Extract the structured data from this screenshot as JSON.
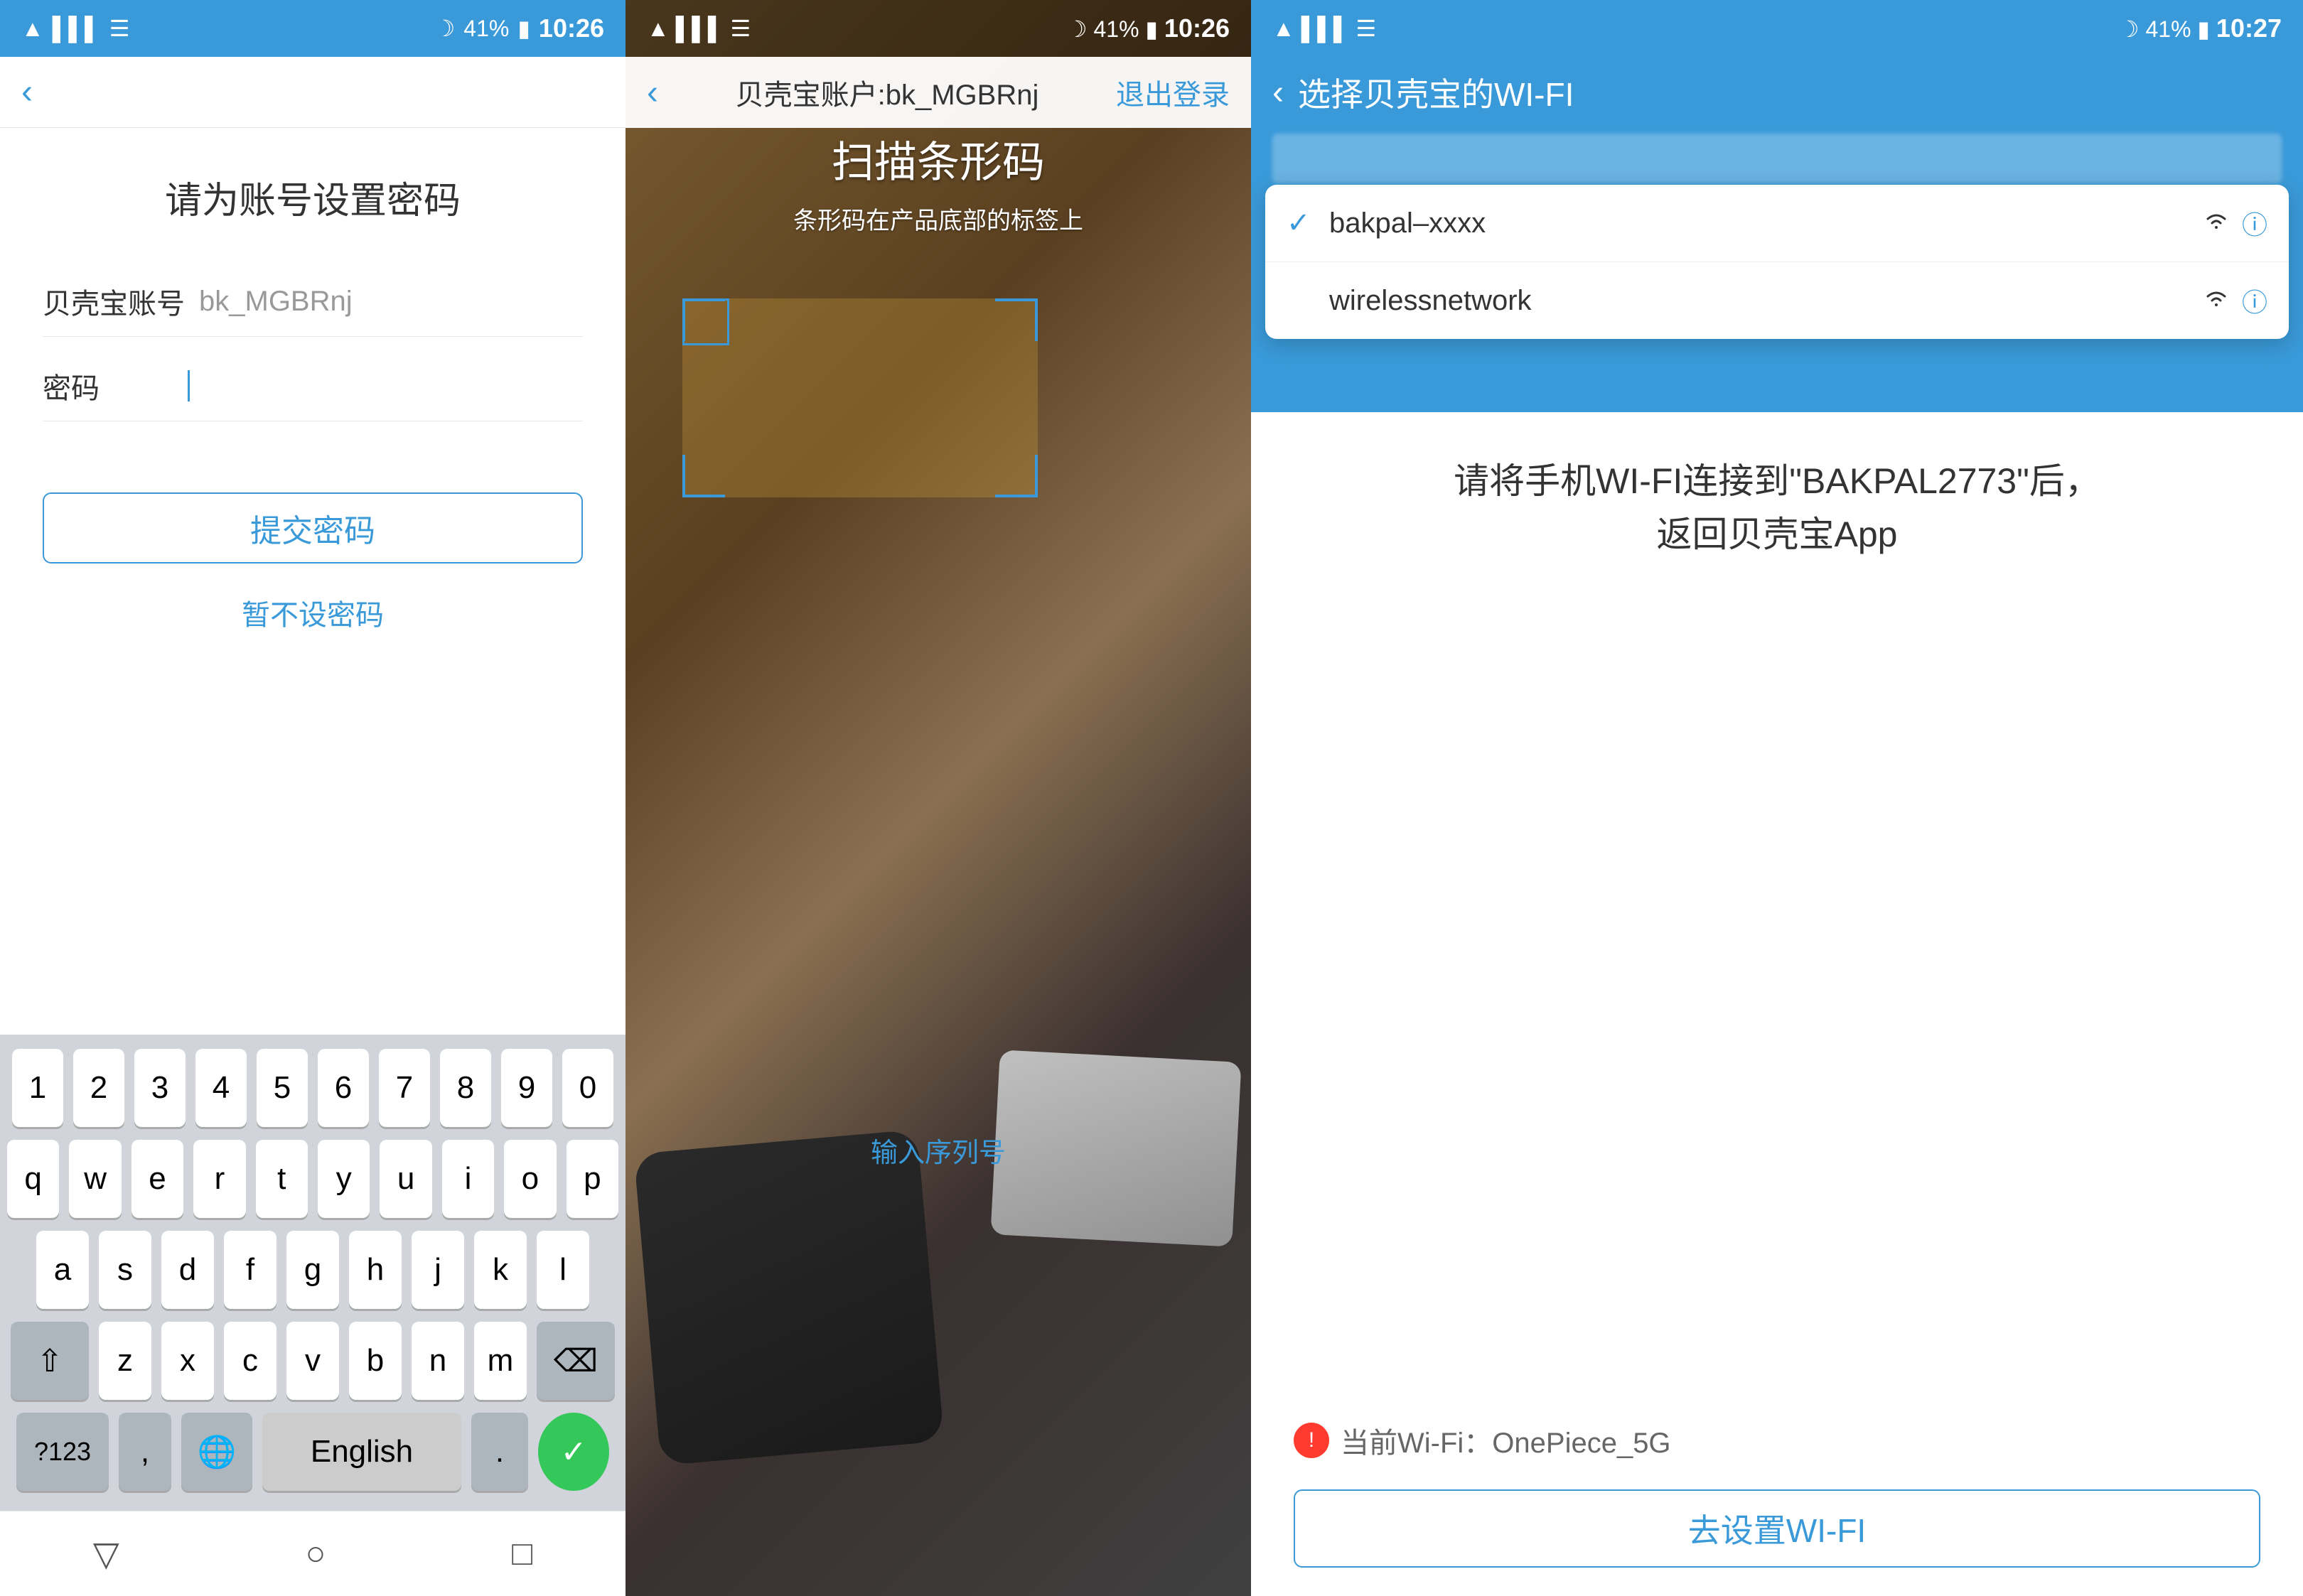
{
  "panel1": {
    "statusBar": {
      "leftIcons": "wifi signal",
      "time": "10:26",
      "batteryPercent": "41%"
    },
    "title": "请为账号设置密码",
    "accountLabel": "贝壳宝账号",
    "accountValue": "bk_MGBRnj",
    "passwordLabel": "密码",
    "submitBtn": "提交密码",
    "skipLink": "暂不设密码",
    "keyboard": {
      "row1": [
        "1",
        "2",
        "3",
        "4",
        "5",
        "6",
        "7",
        "8",
        "9",
        "0"
      ],
      "row2": [
        "q",
        "w",
        "e",
        "r",
        "t",
        "y",
        "u",
        "i",
        "o",
        "p"
      ],
      "row3": [
        "a",
        "s",
        "d",
        "f",
        "g",
        "h",
        "j",
        "k",
        "l"
      ],
      "row4": [
        "z",
        "x",
        "c",
        "v",
        "b",
        "n",
        "m"
      ],
      "specialKeys": {
        "shift": "⇧",
        "backspace": "⌫",
        "num": "?123",
        "comma": ",",
        "globe": "🌐",
        "english": "English",
        "dot": ".",
        "send": "✓"
      }
    },
    "navBottom": {
      "back": "▽",
      "home": "○",
      "recent": "□"
    }
  },
  "panel2": {
    "statusBar": {
      "time": "10:26",
      "batteryPercent": "41%"
    },
    "header": {
      "title": "贝壳宝账户:bk_MGBRnj",
      "logout": "退出登录",
      "back": "<"
    },
    "scanTitle": "扫描条形码",
    "scanSubtitle": "条形码在产品底部的标签上",
    "enterSerial": "输入序列号"
  },
  "panel3": {
    "statusBar": {
      "time": "10:27",
      "batteryPercent": "41%"
    },
    "navTitle": "选择贝壳宝的WI-FI",
    "wifiList": [
      {
        "name": "bakpal–xxxx",
        "selected": true
      },
      {
        "name": "wirelessnetwork",
        "selected": false
      }
    ],
    "instruction": "请将手机WI-FI连接到\"BAKPAL2773\"后，\n返回贝壳宝App",
    "currentWifi": {
      "label": "当前Wi-Fi：OnePiece_5G"
    },
    "gotoBtn": "去设置WI-FI"
  }
}
